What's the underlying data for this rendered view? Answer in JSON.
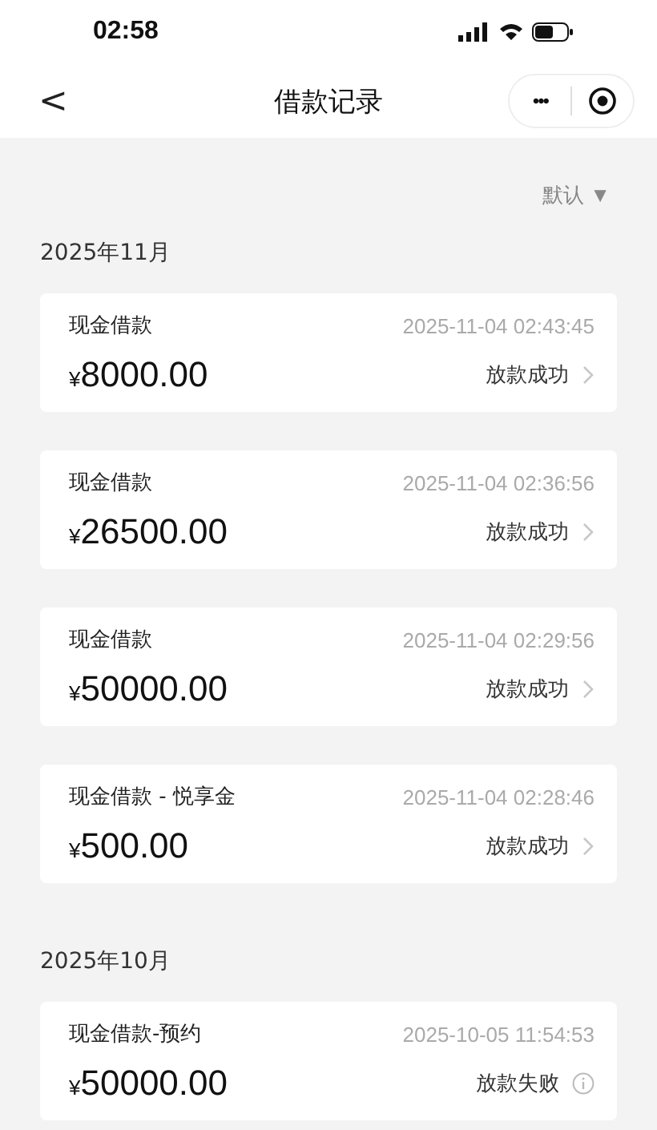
{
  "status_bar": {
    "time": "02:58"
  },
  "nav": {
    "title": "借款记录",
    "back": "<",
    "more": "•••"
  },
  "sort": {
    "label": "默认",
    "caret": "▼"
  },
  "groups": [
    {
      "month": "2025年11月",
      "records": [
        {
          "name": "现金借款",
          "time": "2025-11-04 02:43:45",
          "currency": "¥",
          "amount": "8000.00",
          "status": "放款成功",
          "kind": "success"
        },
        {
          "name": "现金借款",
          "time": "2025-11-04 02:36:56",
          "currency": "¥",
          "amount": "26500.00",
          "status": "放款成功",
          "kind": "success"
        },
        {
          "name": "现金借款",
          "time": "2025-11-04 02:29:56",
          "currency": "¥",
          "amount": "50000.00",
          "status": "放款成功",
          "kind": "success"
        },
        {
          "name": "现金借款 - 悦享金",
          "time": "2025-11-04 02:28:46",
          "currency": "¥",
          "amount": "500.00",
          "status": "放款成功",
          "kind": "success"
        }
      ]
    },
    {
      "month": "2025年10月",
      "records": [
        {
          "name": "现金借款-预约",
          "time": "2025-10-05 11:54:53",
          "currency": "¥",
          "amount": "50000.00",
          "status": "放款失败",
          "kind": "failed"
        }
      ]
    }
  ]
}
